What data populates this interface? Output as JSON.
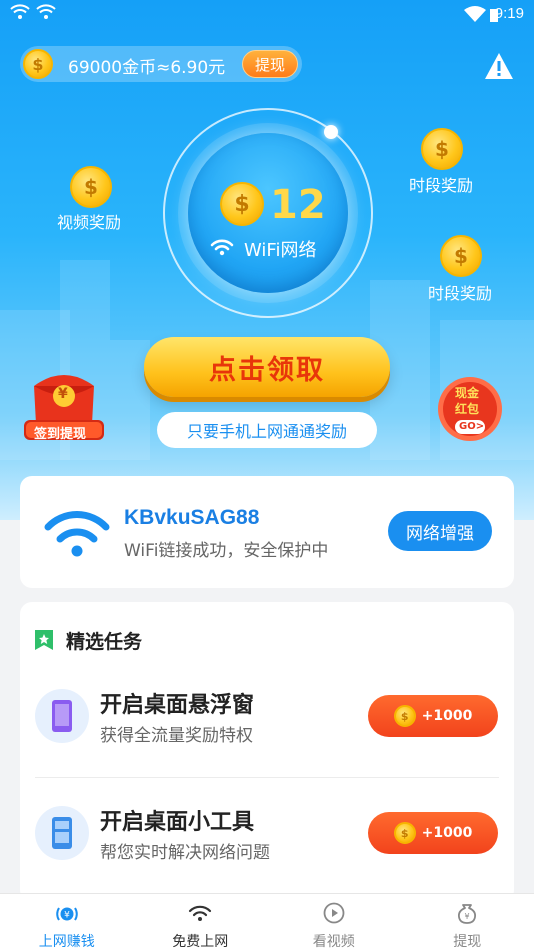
{
  "status_bar": {
    "time": "9:19"
  },
  "balance": {
    "text": "69000金币≈6.90元",
    "withdraw_label": "提现",
    "coin_symbol": "$"
  },
  "hero": {
    "count": "12",
    "network_label": "WiFi网络",
    "float_rewards": [
      {
        "label": "视频奖励"
      },
      {
        "label": "时段奖励"
      },
      {
        "label": "时段奖励"
      }
    ],
    "claim_button": "点击领取",
    "hint": "只要手机上网通通奖励",
    "badge_left": {
      "label": "签到提现",
      "symbol": "¥"
    },
    "badge_right": {
      "line1": "现金",
      "line2": "红包",
      "go": "GO>"
    }
  },
  "wifi_card": {
    "ssid": "KBvkuSAG88",
    "status": "WiFi链接成功，安全保护中",
    "enhance_button": "网络增强"
  },
  "tasks": {
    "title": "精选任务",
    "items": [
      {
        "title": "开启桌面悬浮窗",
        "subtitle": "获得全流量奖励特权",
        "reward": "+1000",
        "icon": "floating-window-icon"
      },
      {
        "title": "开启桌面小工具",
        "subtitle": "帮您实时解决网络问题",
        "reward": "+1000",
        "icon": "desktop-widget-icon"
      }
    ]
  },
  "bottom_nav": {
    "items": [
      {
        "label": "上网赚钱",
        "icon": "earn-icon",
        "active": true
      },
      {
        "label": "免费上网",
        "icon": "wifi-icon",
        "active": false
      },
      {
        "label": "看视频",
        "icon": "play-icon",
        "active": false
      },
      {
        "label": "提现",
        "icon": "money-bag-icon",
        "active": false
      }
    ]
  },
  "colors": {
    "primary": "#1a8ff0",
    "accent_orange": "#f2431c",
    "gold": "#ffc61a",
    "claim_text": "#e8360a"
  }
}
